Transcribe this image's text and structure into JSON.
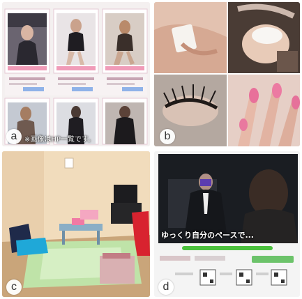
{
  "panels": {
    "a": {
      "letter": "a",
      "caption": "※画像はHP一覧です。"
    },
    "b": {
      "letter": "b"
    },
    "c": {
      "letter": "c"
    },
    "d": {
      "letter": "d",
      "video_caption": "ゆっくり自分のペースで..."
    }
  }
}
